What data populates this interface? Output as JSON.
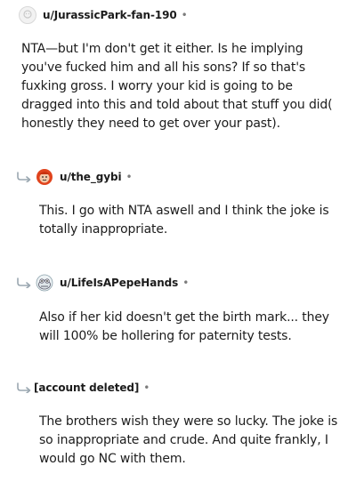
{
  "comments": [
    {
      "username": "u/JurassicPark-fan-190",
      "separator": "•",
      "body": "NTA—but I'm don't get it either. Is he implying you've fucked him and all his sons? If so that's fuxking gross. I worry your kid is going to be dragged into this and told about that stuff you did( honestly they need to get over your past)."
    },
    {
      "username": "u/the_gybi",
      "separator": "•",
      "body": "This. I go with NTA aswell and I think the joke is totally inappropriate."
    },
    {
      "username": "u/LifeIsAPepeHands",
      "separator": "•",
      "body": "Also if her kid doesn't get the birth mark... they will 100% be hollering for paternity tests."
    },
    {
      "username": "[account deleted]",
      "separator": "•",
      "body": "The brothers wish they were so lucky. The joke is so inappropriate and crude. And quite frankly, I would go NC with them."
    }
  ],
  "icons": {
    "reply": "reply-arrow-icon",
    "avatar_default": "default-avatar-icon",
    "avatar_red": "red-character-avatar-icon",
    "avatar_pepe": "frog-character-avatar-icon"
  },
  "colors": {
    "text": "#1c1c1c",
    "meta": "#7c7c7c",
    "reply_arrow": "#9aa7b0"
  }
}
